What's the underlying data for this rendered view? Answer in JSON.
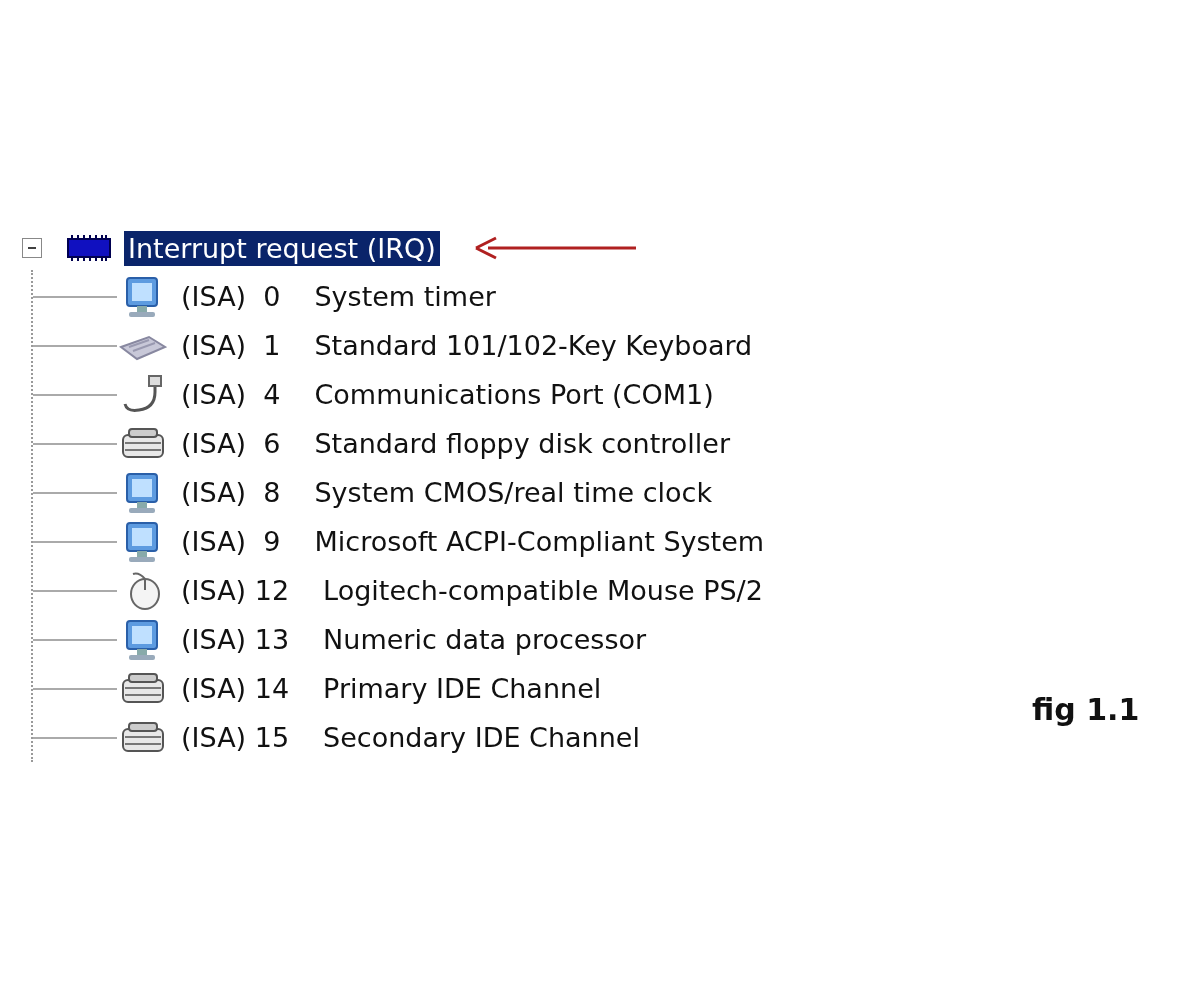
{
  "tree": {
    "label": "Interrupt request (IRQ)",
    "selected": true,
    "expanded": true,
    "children": [
      {
        "kind": "system",
        "irq": "(ISA)  0",
        "name": "System timer"
      },
      {
        "kind": "keyboard",
        "irq": "(ISA)  1",
        "name": "Standard 101/102-Key Keyboard"
      },
      {
        "kind": "port",
        "irq": "(ISA)  4",
        "name": "Communications Port (COM1)"
      },
      {
        "kind": "drive",
        "irq": "(ISA)  6",
        "name": "Standard floppy disk controller"
      },
      {
        "kind": "system",
        "irq": "(ISA)  8",
        "name": "System CMOS/real time clock"
      },
      {
        "kind": "system",
        "irq": "(ISA)  9",
        "name": "Microsoft ACPI-Compliant System"
      },
      {
        "kind": "mouse",
        "irq": "(ISA) 12",
        "name": "Logitech-compatible Mouse PS/2"
      },
      {
        "kind": "system",
        "irq": "(ISA) 13",
        "name": "Numeric data processor"
      },
      {
        "kind": "drive",
        "irq": "(ISA) 14",
        "name": "Primary IDE Channel"
      },
      {
        "kind": "drive",
        "irq": "(ISA) 15",
        "name": "Secondary IDE Channel"
      }
    ]
  },
  "figure_label": "fig 1.1"
}
